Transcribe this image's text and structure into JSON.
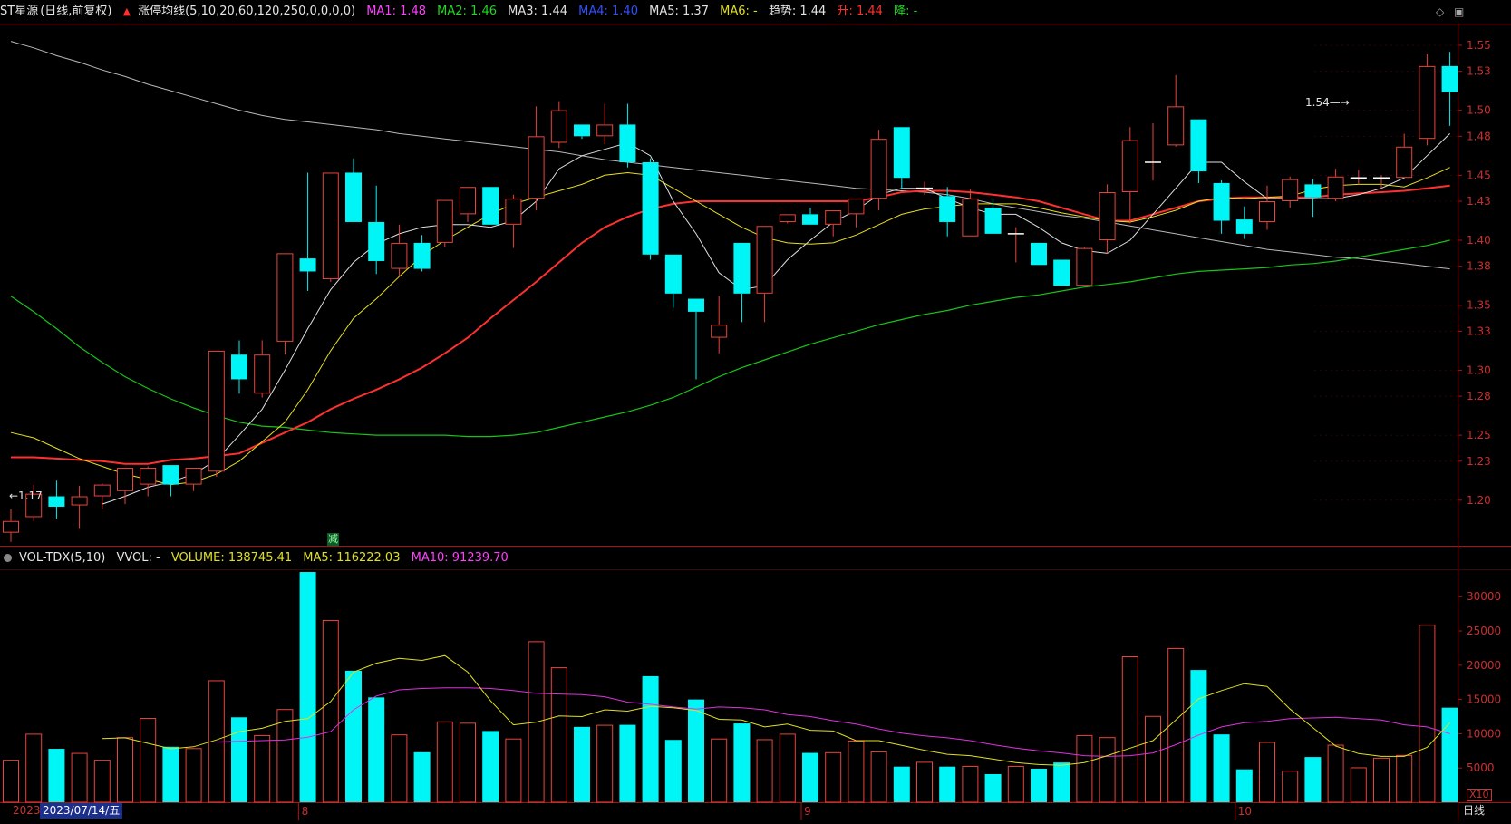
{
  "price_header": {
    "stock": "ST星源",
    "mode": "(日线,前复权)",
    "indicator": "涨停均线(5,10,20,60,120,250,0,0,0,0)",
    "ma1": "MA1: 1.48",
    "ma2": "MA2: 1.46",
    "ma3": "MA3: 1.44",
    "ma4": "MA4: 1.40",
    "ma5": "MA5: 1.37",
    "ma6": "MA6: -",
    "trend": "趋势: 1.44",
    "up": "升: 1.44",
    "down": "降: -"
  },
  "volume_header": {
    "name": "VOL-TDX(5,10)",
    "vvol": "VVOL: -",
    "volume": "VOLUME: 138745.41",
    "ma5": "MA5: 116222.03",
    "ma10": "MA10: 91239.70"
  },
  "footer": {
    "date_label": "2023/07/14/五",
    "year_stub": "2023",
    "daily_label": "日线",
    "scale_label": "X10",
    "month_ticks": [
      "8",
      "9",
      "10"
    ]
  },
  "marker": {
    "jian": "减"
  },
  "colors": {
    "up": "#e8443c",
    "down": "#00f6f6",
    "ma1": "#e0e0e0",
    "ma2": "#e8e020",
    "ma3": "#ff3030",
    "ma4": "#18c418",
    "ma5": "#b8b8b8",
    "vol_ma5": "#e0e020",
    "vol_ma10": "#e030e0",
    "axis": "#b01010"
  },
  "chart_data": [
    {
      "type": "candlestick",
      "title": "ST星源",
      "ylim": [
        1.165,
        1.566
      ],
      "y_ticks": [
        "1.20",
        "1.23",
        "1.25",
        "1.28",
        "1.30",
        "1.33",
        "1.35",
        "1.38",
        "1.40",
        "1.43",
        "1.45",
        "1.48",
        "1.50",
        "1.53",
        "1.55"
      ],
      "annotations": {
        "low": "←1.17",
        "high": "1.54—→"
      },
      "candles": [
        {
          "o": 1.175,
          "h": 1.193,
          "l": 1.168,
          "c": 1.184
        },
        {
          "o": 1.187,
          "h": 1.212,
          "l": 1.184,
          "c": 1.205
        },
        {
          "o": 1.203,
          "h": 1.215,
          "l": 1.186,
          "c": 1.195
        },
        {
          "o": 1.196,
          "h": 1.211,
          "l": 1.178,
          "c": 1.203
        },
        {
          "o": 1.203,
          "h": 1.213,
          "l": 1.193,
          "c": 1.212
        },
        {
          "o": 1.207,
          "h": 1.225,
          "l": 1.197,
          "c": 1.225
        },
        {
          "o": 1.212,
          "h": 1.226,
          "l": 1.203,
          "c": 1.225
        },
        {
          "o": 1.227,
          "h": 1.227,
          "l": 1.203,
          "c": 1.212
        },
        {
          "o": 1.212,
          "h": 1.225,
          "l": 1.207,
          "c": 1.225
        },
        {
          "o": 1.222,
          "h": 1.315,
          "l": 1.218,
          "c": 1.315
        },
        {
          "o": 1.312,
          "h": 1.323,
          "l": 1.282,
          "c": 1.293
        },
        {
          "o": 1.282,
          "h": 1.323,
          "l": 1.279,
          "c": 1.312
        },
        {
          "o": 1.322,
          "h": 1.39,
          "l": 1.312,
          "c": 1.39
        },
        {
          "o": 1.386,
          "h": 1.452,
          "l": 1.361,
          "c": 1.376
        },
        {
          "o": 1.37,
          "h": 1.452,
          "l": 1.368,
          "c": 1.452
        },
        {
          "o": 1.452,
          "h": 1.463,
          "l": 1.414,
          "c": 1.414
        },
        {
          "o": 1.414,
          "h": 1.442,
          "l": 1.374,
          "c": 1.384
        },
        {
          "o": 1.378,
          "h": 1.412,
          "l": 1.372,
          "c": 1.398
        },
        {
          "o": 1.398,
          "h": 1.404,
          "l": 1.376,
          "c": 1.378
        },
        {
          "o": 1.398,
          "h": 1.431,
          "l": 1.395,
          "c": 1.431
        },
        {
          "o": 1.42,
          "h": 1.441,
          "l": 1.414,
          "c": 1.441
        },
        {
          "o": 1.441,
          "h": 1.441,
          "l": 1.412,
          "c": 1.412
        },
        {
          "o": 1.412,
          "h": 1.435,
          "l": 1.394,
          "c": 1.432
        },
        {
          "o": 1.432,
          "h": 1.503,
          "l": 1.423,
          "c": 1.48
        },
        {
          "o": 1.475,
          "h": 1.507,
          "l": 1.471,
          "c": 1.5
        },
        {
          "o": 1.489,
          "h": 1.489,
          "l": 1.478,
          "c": 1.48
        },
        {
          "o": 1.48,
          "h": 1.505,
          "l": 1.474,
          "c": 1.489
        },
        {
          "o": 1.489,
          "h": 1.505,
          "l": 1.456,
          "c": 1.46
        },
        {
          "o": 1.46,
          "h": 1.463,
          "l": 1.385,
          "c": 1.389
        },
        {
          "o": 1.389,
          "h": 1.389,
          "l": 1.348,
          "c": 1.359
        },
        {
          "o": 1.355,
          "h": 1.355,
          "l": 1.293,
          "c": 1.345
        },
        {
          "o": 1.325,
          "h": 1.357,
          "l": 1.313,
          "c": 1.335
        },
        {
          "o": 1.398,
          "h": 1.398,
          "l": 1.337,
          "c": 1.359
        },
        {
          "o": 1.359,
          "h": 1.411,
          "l": 1.337,
          "c": 1.411
        },
        {
          "o": 1.414,
          "h": 1.42,
          "l": 1.413,
          "c": 1.42
        },
        {
          "o": 1.42,
          "h": 1.425,
          "l": 1.412,
          "c": 1.412
        },
        {
          "o": 1.412,
          "h": 1.423,
          "l": 1.403,
          "c": 1.423
        },
        {
          "o": 1.42,
          "h": 1.425,
          "l": 1.41,
          "c": 1.432
        },
        {
          "o": 1.432,
          "h": 1.485,
          "l": 1.423,
          "c": 1.478
        },
        {
          "o": 1.487,
          "h": 1.487,
          "l": 1.439,
          "c": 1.448
        },
        {
          "o": 1.44,
          "h": 1.445,
          "l": 1.435,
          "c": 1.44
        },
        {
          "o": 1.434,
          "h": 1.441,
          "l": 1.403,
          "c": 1.414
        },
        {
          "o": 1.403,
          "h": 1.439,
          "l": 1.403,
          "c": 1.432
        },
        {
          "o": 1.425,
          "h": 1.432,
          "l": 1.405,
          "c": 1.405
        },
        {
          "o": 1.405,
          "h": 1.41,
          "l": 1.383,
          "c": 1.405
        },
        {
          "o": 1.398,
          "h": 1.398,
          "l": 1.381,
          "c": 1.381
        },
        {
          "o": 1.385,
          "h": 1.385,
          "l": 1.365,
          "c": 1.365
        },
        {
          "o": 1.365,
          "h": 1.395,
          "l": 1.365,
          "c": 1.394
        },
        {
          "o": 1.4,
          "h": 1.443,
          "l": 1.39,
          "c": 1.437
        },
        {
          "o": 1.437,
          "h": 1.487,
          "l": 1.413,
          "c": 1.477
        },
        {
          "o": 1.46,
          "h": 1.49,
          "l": 1.446,
          "c": 1.46
        },
        {
          "o": 1.473,
          "h": 1.527,
          "l": 1.472,
          "c": 1.503
        },
        {
          "o": 1.493,
          "h": 1.493,
          "l": 1.444,
          "c": 1.453
        },
        {
          "o": 1.444,
          "h": 1.446,
          "l": 1.405,
          "c": 1.415
        },
        {
          "o": 1.416,
          "h": 1.426,
          "l": 1.401,
          "c": 1.405
        },
        {
          "o": 1.414,
          "h": 1.442,
          "l": 1.408,
          "c": 1.43
        },
        {
          "o": 1.43,
          "h": 1.449,
          "l": 1.425,
          "c": 1.447
        },
        {
          "o": 1.443,
          "h": 1.447,
          "l": 1.418,
          "c": 1.433
        },
        {
          "o": 1.432,
          "h": 1.455,
          "l": 1.43,
          "c": 1.449
        },
        {
          "o": 1.448,
          "h": 1.454,
          "l": 1.443,
          "c": 1.448
        },
        {
          "o": 1.448,
          "h": 1.45,
          "l": 1.44,
          "c": 1.448
        },
        {
          "o": 1.448,
          "h": 1.482,
          "l": 1.448,
          "c": 1.472
        },
        {
          "o": 1.478,
          "h": 1.543,
          "l": 1.473,
          "c": 1.534
        },
        {
          "o": 1.534,
          "h": 1.545,
          "l": 1.488,
          "c": 1.514
        }
      ],
      "ma_lines": {
        "ma1": [
          null,
          null,
          null,
          null,
          1.197,
          1.203,
          1.21,
          1.214,
          1.22,
          1.231,
          1.25,
          1.27,
          1.3,
          1.332,
          1.362,
          1.383,
          1.397,
          1.405,
          1.41,
          1.412,
          1.412,
          1.41,
          1.415,
          1.43,
          1.455,
          1.465,
          1.47,
          1.475,
          1.465,
          1.43,
          1.405,
          1.375,
          1.362,
          1.365,
          1.385,
          1.4,
          1.414,
          1.423,
          1.435,
          1.44,
          1.44,
          1.432,
          1.425,
          1.42,
          1.42,
          1.41,
          1.398,
          1.392,
          1.39,
          1.4,
          1.42,
          1.44,
          1.46,
          1.46,
          1.445,
          1.432,
          1.432,
          1.432,
          1.432,
          1.435,
          1.44,
          1.448,
          1.465,
          1.482
        ],
        "ma2": [
          1.252,
          1.248,
          1.24,
          1.232,
          1.226,
          1.22,
          1.216,
          1.212,
          1.214,
          1.22,
          1.23,
          1.245,
          1.26,
          1.285,
          1.315,
          1.34,
          1.355,
          1.372,
          1.388,
          1.4,
          1.41,
          1.42,
          1.428,
          1.433,
          1.438,
          1.443,
          1.45,
          1.452,
          1.45,
          1.44,
          1.43,
          1.42,
          1.41,
          1.402,
          1.398,
          1.397,
          1.398,
          1.404,
          1.412,
          1.42,
          1.424,
          1.426,
          1.428,
          1.428,
          1.428,
          1.425,
          1.421,
          1.418,
          1.415,
          1.414,
          1.418,
          1.423,
          1.43,
          1.433,
          1.432,
          1.433,
          1.434,
          1.439,
          1.442,
          1.443,
          1.443,
          1.441,
          1.448,
          1.456
        ],
        "ma3": [
          1.233,
          1.233,
          1.232,
          1.231,
          1.23,
          1.228,
          1.228,
          1.231,
          1.232,
          1.234,
          1.236,
          1.244,
          1.252,
          1.26,
          1.27,
          1.278,
          1.285,
          1.293,
          1.302,
          1.313,
          1.325,
          1.34,
          1.354,
          1.368,
          1.383,
          1.398,
          1.41,
          1.418,
          1.424,
          1.428,
          1.43,
          1.43,
          1.43,
          1.43,
          1.43,
          1.43,
          1.43,
          1.43,
          1.433,
          1.437,
          1.438,
          1.438,
          1.437,
          1.435,
          1.433,
          1.43,
          1.425,
          1.42,
          1.415,
          1.415,
          1.42,
          1.425,
          1.43,
          1.432,
          1.433,
          1.433,
          1.433,
          1.433,
          1.435,
          1.436,
          1.437,
          1.438,
          1.44,
          1.442
        ],
        "ma4": [
          1.357,
          1.345,
          1.332,
          1.318,
          1.306,
          1.295,
          1.286,
          1.278,
          1.271,
          1.265,
          1.26,
          1.257,
          1.256,
          1.254,
          1.252,
          1.251,
          1.25,
          1.25,
          1.25,
          1.25,
          1.249,
          1.249,
          1.25,
          1.252,
          1.256,
          1.26,
          1.264,
          1.268,
          1.273,
          1.279,
          1.287,
          1.295,
          1.302,
          1.308,
          1.314,
          1.32,
          1.325,
          1.33,
          1.335,
          1.339,
          1.343,
          1.346,
          1.35,
          1.353,
          1.356,
          1.358,
          1.361,
          1.364,
          1.366,
          1.368,
          1.371,
          1.374,
          1.376,
          1.377,
          1.378,
          1.379,
          1.381,
          1.382,
          1.384,
          1.387,
          1.39,
          1.393,
          1.396,
          1.4
        ],
        "ma5": [
          1.553,
          1.548,
          1.542,
          1.537,
          1.531,
          1.526,
          1.52,
          1.515,
          1.51,
          1.505,
          1.5,
          1.496,
          1.493,
          1.491,
          1.489,
          1.487,
          1.485,
          1.482,
          1.48,
          1.478,
          1.476,
          1.474,
          1.472,
          1.47,
          1.468,
          1.465,
          1.462,
          1.46,
          1.458,
          1.456,
          1.454,
          1.452,
          1.45,
          1.448,
          1.446,
          1.444,
          1.442,
          1.44,
          1.439,
          1.438,
          1.437,
          1.435,
          1.432,
          1.428,
          1.425,
          1.422,
          1.419,
          1.417,
          1.414,
          1.411,
          1.408,
          1.405,
          1.402,
          1.399,
          1.396,
          1.393,
          1.391,
          1.389,
          1.387,
          1.386,
          1.384,
          1.382,
          1.38,
          1.378
        ]
      }
    },
    {
      "type": "bar",
      "title": "VOL-TDX(5,10)",
      "ylim": [
        0,
        34000
      ],
      "y_ticks": [
        "5000",
        "10000",
        "15000",
        "20000",
        "25000",
        "30000"
      ],
      "volumes": [
        6200,
        10000,
        7800,
        7200,
        6200,
        9500,
        12300,
        8100,
        7900,
        17800,
        12400,
        9800,
        13600,
        33600,
        26600,
        19200,
        15300,
        9900,
        7300,
        11800,
        11600,
        10400,
        9300,
        23500,
        19700,
        11000,
        11300,
        11300,
        18400,
        9100,
        15000,
        9300,
        11500,
        9200,
        10000,
        7200,
        7300,
        9000,
        7400,
        5200,
        5900,
        5200,
        5300,
        4100,
        5300,
        4900,
        5800,
        9800,
        9500,
        21300,
        12600,
        22500,
        19300,
        9900,
        4800,
        8800,
        4600,
        6600,
        8400,
        5100,
        6500,
        6900,
        25900,
        13800
      ],
      "ma5": [
        null,
        null,
        null,
        null,
        9300,
        9400,
        8600,
        7800,
        8100,
        9100,
        10300,
        10800,
        11800,
        12200,
        14700,
        19000,
        20300,
        21000,
        20700,
        21400,
        19000,
        14800,
        11300,
        11700,
        12600,
        12500,
        13500,
        13300,
        14000,
        13800,
        13400,
        12100,
        12000,
        11000,
        11400,
        10500,
        10400,
        9000,
        9000,
        8300,
        7600,
        7000,
        6800,
        6300,
        5800,
        5500,
        5400,
        5800,
        6800,
        7900,
        9000,
        12000,
        15100,
        16300,
        17300,
        16900,
        13600,
        10900,
        8200,
        7100,
        6700,
        6700,
        8000,
        11600
      ],
      "ma10": [
        null,
        null,
        null,
        null,
        null,
        null,
        null,
        null,
        null,
        8800,
        8900,
        9000,
        9100,
        9500,
        10300,
        13500,
        15500,
        16400,
        16600,
        16700,
        16700,
        16600,
        16300,
        15900,
        15800,
        15700,
        15400,
        14600,
        14300,
        13900,
        13600,
        13900,
        13800,
        13500,
        12800,
        12500,
        11900,
        11400,
        10700,
        10100,
        9700,
        9400,
        9000,
        8400,
        7900,
        7500,
        7200,
        6800,
        6700,
        6800,
        7200,
        8400,
        9800,
        11000,
        11600,
        11800,
        12200,
        12300,
        12400,
        12200,
        12000,
        11300,
        11000,
        10000,
        9200
      ]
    }
  ]
}
